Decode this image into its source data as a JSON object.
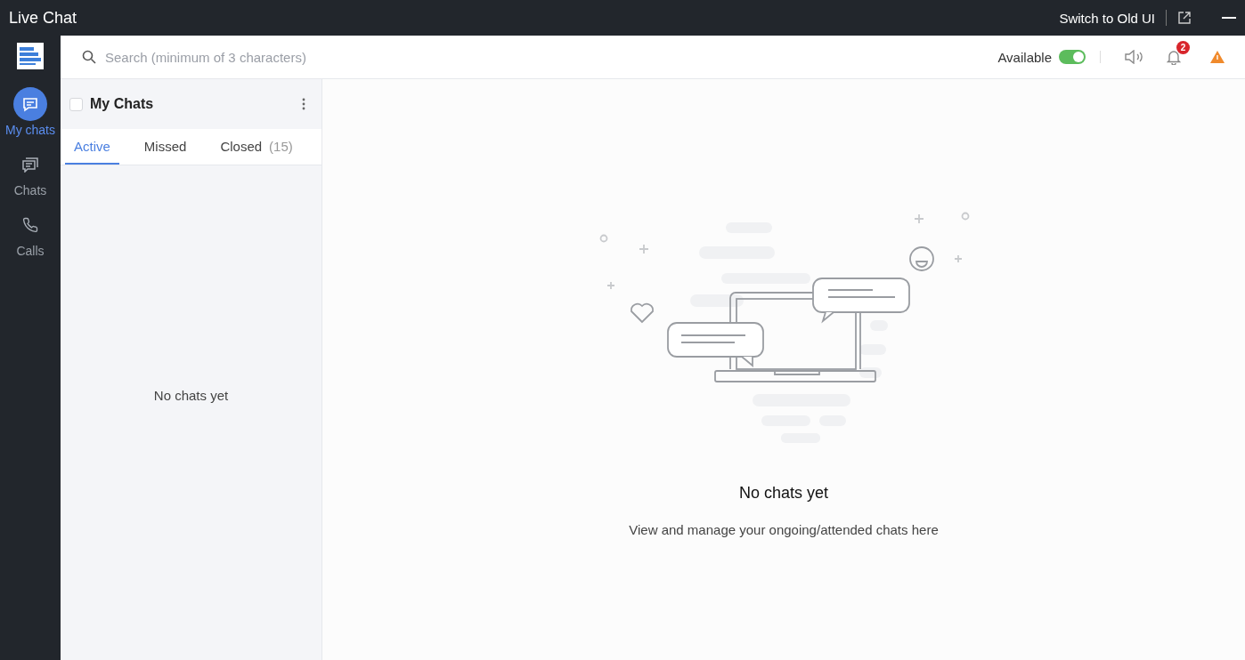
{
  "window": {
    "title": "Live Chat",
    "switch_link": "Switch to Old UI"
  },
  "nav": [
    {
      "label": "My chats",
      "kind": "chat",
      "selected": true
    },
    {
      "label": "Chats",
      "kind": "chats",
      "selected": false
    },
    {
      "label": "Calls",
      "kind": "phone",
      "selected": false
    }
  ],
  "search": {
    "placeholder": "Search (minimum of 3 characters)"
  },
  "status": {
    "label": "Available",
    "on": true
  },
  "notifications": {
    "count": "2"
  },
  "list": {
    "title": "My Chats",
    "checked": false,
    "tabs": [
      {
        "label": "Active",
        "selected": true
      },
      {
        "label": "Missed",
        "selected": false
      },
      {
        "label": "Closed",
        "count": "(15)",
        "selected": false
      }
    ],
    "empty": "No chats yet"
  },
  "empty_state": {
    "title": "No chats yet",
    "text": "View and manage your ongoing/attended chats here"
  }
}
